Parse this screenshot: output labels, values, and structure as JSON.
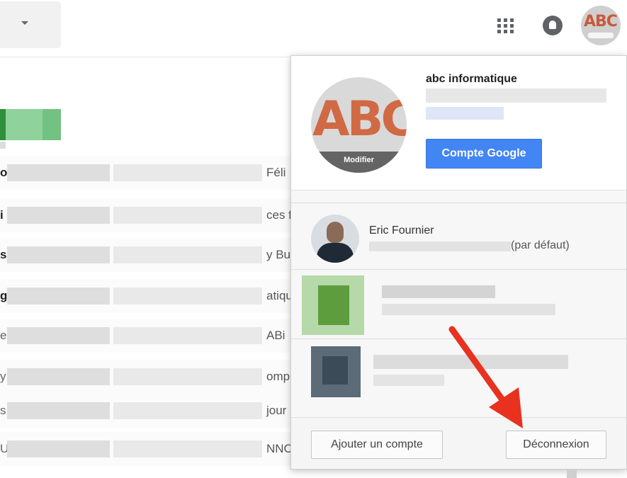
{
  "topbar": {
    "apps_icon": "apps-grid-icon",
    "notifications_icon": "bell-icon",
    "avatar_icon": "abc-logo-avatar"
  },
  "mail_list": {
    "rows": [
      {
        "lead": "o",
        "suffix": "Féli"
      },
      {
        "lead": "i",
        "suffix": "ces f"
      },
      {
        "lead": "s",
        "suffix": "y Bu"
      },
      {
        "lead": "g",
        "suffix": "atiqu"
      },
      {
        "lead": "e",
        "suffix": "ABi"
      },
      {
        "lead": "y",
        "suffix": "omp"
      },
      {
        "lead": "s",
        "suffix": "jour"
      },
      {
        "lead": "U",
        "suffix": "NNC"
      }
    ]
  },
  "account_popup": {
    "current_account": {
      "name": "abc informatique",
      "avatar_text": "ABC",
      "modify_label": "Modifier",
      "google_account_button": "Compte Google"
    },
    "other_accounts": [
      {
        "name": "Eric Fournier",
        "default_label": "(par défaut)"
      }
    ],
    "add_account_button": "Ajouter un compte",
    "logout_button": "Déconnexion"
  },
  "colors": {
    "google_blue": "#4285f4",
    "arrow_red": "#e8321f",
    "logo_orange": "#d06a44"
  }
}
